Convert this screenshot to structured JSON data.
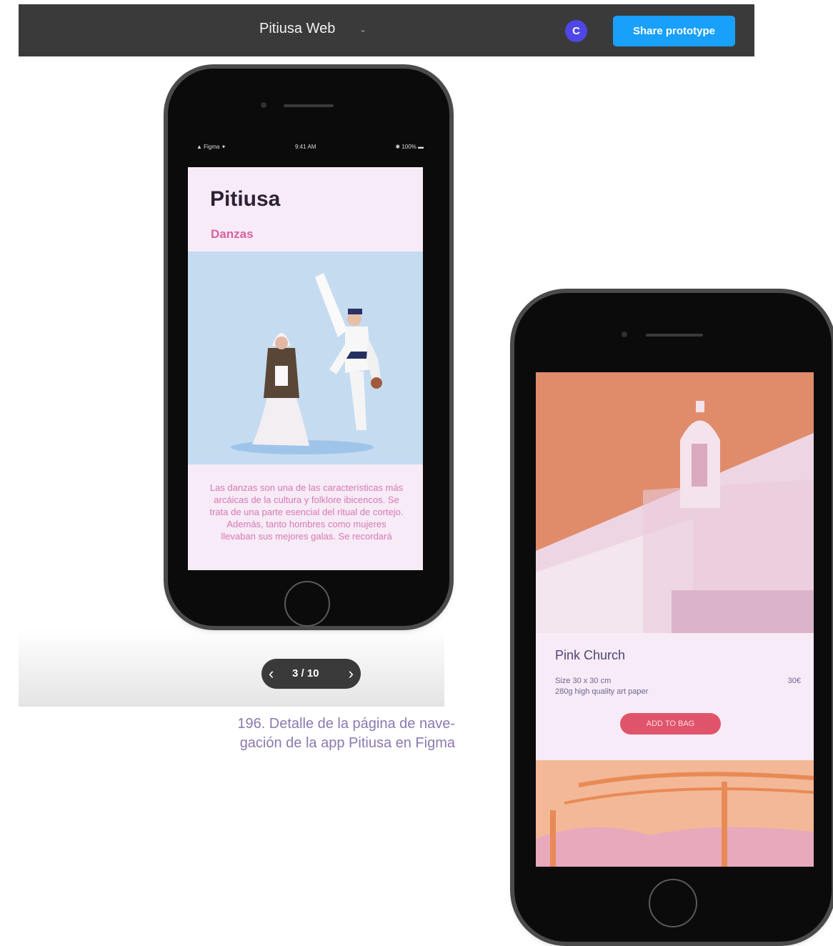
{
  "topbar": {
    "file_title": "Pitiusa Web",
    "avatar_initial": "C",
    "share_label": "Share prototype",
    "chevron": "⌄"
  },
  "phone1": {
    "status": {
      "carrier": "▲ Figma ✦",
      "time": "9:41 AM",
      "battery": "✱ 100% ▬"
    },
    "app_title": "Pitiusa",
    "section": "Danzas",
    "body_text": "Las danzas son una de las características más arcáicas de la cultura y folklore ibicencos. Se trata de una parte esencial del ritual de cortejo. Además, tanto hombres como mujeres llevaban sus mejores galas. Se recordará"
  },
  "pager": {
    "prev": "‹",
    "position": "3 / 10",
    "next": "›"
  },
  "caption": {
    "line1": "196. Detalle de la página de nave-",
    "line2": "gación de la app Pitiusa en Figma"
  },
  "phone2": {
    "product_name": "Pink Church",
    "size_text": "Size 30 x 30 cm",
    "paper_text": "280g high quality art paper",
    "price": "30€",
    "add_to_bag": "ADD TO BAG"
  },
  "colors": {
    "topbar": "#3a3a3a",
    "accent_blue": "#18a0fb",
    "avatar": "#4f46e5",
    "pink_title": "#d860a3",
    "bag_button": "#e0546b"
  }
}
